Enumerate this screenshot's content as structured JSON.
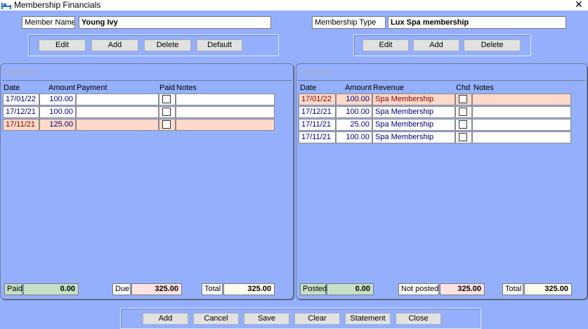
{
  "window": {
    "title": "Membership Financials",
    "close_glyph": "✕",
    "icon": "bed-icon"
  },
  "member": {
    "name_label": "Member Name",
    "name_value": "Young Ivy",
    "type_label": "Membership Type",
    "type_value": "Lux Spa membership"
  },
  "member_buttons": {
    "edit": "Edit",
    "add": "Add",
    "delete": "Delete",
    "default": "Default"
  },
  "type_buttons": {
    "edit": "Edit",
    "add": "Add",
    "delete": "Delete"
  },
  "payments": {
    "title": "Payments",
    "headers": {
      "date": "Date",
      "amount": "Amount",
      "payment": "Payment",
      "paid": "Paid",
      "notes": "Notes"
    },
    "rows": [
      {
        "date": "17/01/22",
        "amount": "100.00",
        "payment": "",
        "paid": false,
        "notes": ""
      },
      {
        "date": "17/12/21",
        "amount": "100.00",
        "payment": "",
        "paid": false,
        "notes": ""
      },
      {
        "date": "17/11/21",
        "amount": "125.00",
        "payment": "",
        "paid": false,
        "notes": "",
        "selected": true
      }
    ],
    "footer": {
      "paid_label": "Paid",
      "paid_value": "0.00",
      "due_label": "Due",
      "due_value": "325.00",
      "total_label": "Total",
      "total_value": "325.00"
    }
  },
  "revenue": {
    "title": "Revenue",
    "headers": {
      "date": "Date",
      "amount": "Amount",
      "revenue": "Revenue",
      "chd": "Chd",
      "notes": "Notes"
    },
    "rows": [
      {
        "date": "17/01/22",
        "amount": "100.00",
        "revenue": "Spa Membership",
        "chd": false,
        "notes": "",
        "selected": true
      },
      {
        "date": "17/12/21",
        "amount": "100.00",
        "revenue": "Spa Membership",
        "chd": false,
        "notes": ""
      },
      {
        "date": "17/11/21",
        "amount": "25.00",
        "revenue": "Spa Membership",
        "chd": false,
        "notes": ""
      },
      {
        "date": "17/11/21",
        "amount": "100.00",
        "revenue": "Spa Membership",
        "chd": false,
        "notes": ""
      }
    ],
    "footer": {
      "posted_label": "Posted",
      "posted_value": "0.00",
      "not_posted_label": "Not posted",
      "not_posted_value": "325.00",
      "total_label": "Total",
      "total_value": "325.00"
    }
  },
  "bottom_buttons": {
    "add": "Add",
    "cancel": "Cancel",
    "save": "Save",
    "clear": "Clear",
    "statement": "Statement",
    "close": "Close"
  },
  "colors": {
    "background": "#94b0fc",
    "selected_row": "#ffd9c9",
    "paid_field": "#c6e0c6",
    "due_field": "#ffe3e3",
    "total_field": "#fffbef",
    "cell_text": "#000078"
  }
}
